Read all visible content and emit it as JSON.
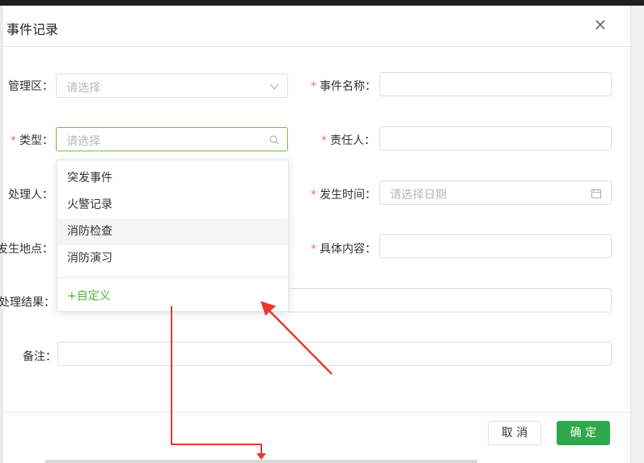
{
  "dialog": {
    "title": "事件记录",
    "close_label": "×"
  },
  "form": {
    "management_area": {
      "label": "管理区：",
      "placeholder": "请选择"
    },
    "event_name": {
      "label": "事件名称：",
      "value": ""
    },
    "type": {
      "label": "类型：",
      "placeholder": "请选择"
    },
    "responsible": {
      "label": "责任人：",
      "value": ""
    },
    "handler": {
      "label": "处理人："
    },
    "occur_time": {
      "label": "发生时间：",
      "placeholder": "请选择日期"
    },
    "location": {
      "label": "发生地点："
    },
    "content": {
      "label": "具体内容：",
      "value": ""
    },
    "result": {
      "label": "处理结果："
    },
    "remark": {
      "label": "备注：",
      "value": ""
    }
  },
  "type_dropdown": {
    "options": [
      "突发事件",
      "火警记录",
      "消防检查",
      "消防演习"
    ],
    "hovered_index": 2,
    "custom_label": "+自定义"
  },
  "footer": {
    "cancel_label": "取 消",
    "ok_label": "确 定"
  },
  "colors": {
    "accent_green": "#2ea84a",
    "required_red": "#f56c6c",
    "annotation_red": "#e53935"
  }
}
